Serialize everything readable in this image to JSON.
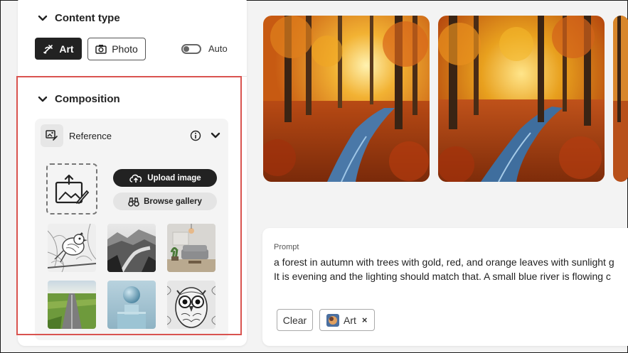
{
  "content_type": {
    "title": "Content type",
    "art_label": "Art",
    "photo_label": "Photo",
    "auto_label": "Auto"
  },
  "composition": {
    "title": "Composition",
    "reference_label": "Reference",
    "upload_label": "Upload image",
    "gallery_label": "Browse gallery"
  },
  "prompt": {
    "label": "Prompt",
    "line1": "a forest in autumn with trees with gold, red, and orange leaves with sunlight g",
    "line2": "It is evening and the lighting should match that. A small blue river is flowing c",
    "clear_label": "Clear",
    "chip_label": "Art",
    "chip_close": "×"
  },
  "colors": {
    "accent_dark": "#222222",
    "highlight": "#d9534f"
  }
}
